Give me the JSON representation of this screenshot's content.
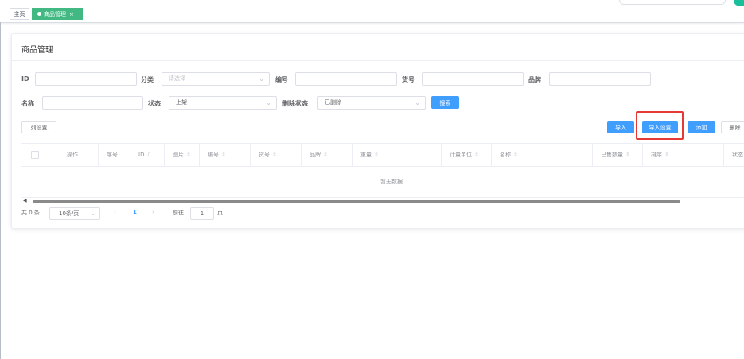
{
  "tags": {
    "home": "主页",
    "active": "商品管理",
    "close": "×"
  },
  "card": {
    "title": "商品管理"
  },
  "filters": {
    "id_label": "ID",
    "id_value": "",
    "category_label": "分类",
    "category_placeholder": "请选择",
    "code_label": "编号",
    "code_value": "",
    "goods_no_label": "货号",
    "goods_no_value": "",
    "brand_label": "品牌",
    "brand_value": "",
    "name_label": "名称",
    "name_value": "",
    "status_label": "状态",
    "status_value": "上架",
    "delete_status_label": "删除状态",
    "delete_status_value": "已删除",
    "search_button": "搜索"
  },
  "toolbar": {
    "column_settings": "列设置",
    "import": "导入",
    "import_settings": "导入设置",
    "add": "添加",
    "delete": "删除"
  },
  "table": {
    "columns": [
      "操作",
      "序号",
      "ID",
      "图片",
      "编号",
      "货号",
      "品牌",
      "重量",
      "计量单位",
      "名称",
      "已售数量",
      "排序",
      "状态"
    ],
    "sort_icon": "⇳",
    "empty_text": "暂无数据"
  },
  "pagination": {
    "total": "共 0 条",
    "page_size": "10条/页",
    "prev": "‹",
    "current": "1",
    "next": "›",
    "goto_label": "前往",
    "goto_value": "1",
    "page_unit": "页"
  },
  "colors": {
    "primary": "#409eff",
    "tag_active": "#42b983",
    "highlight": "#e53935"
  }
}
